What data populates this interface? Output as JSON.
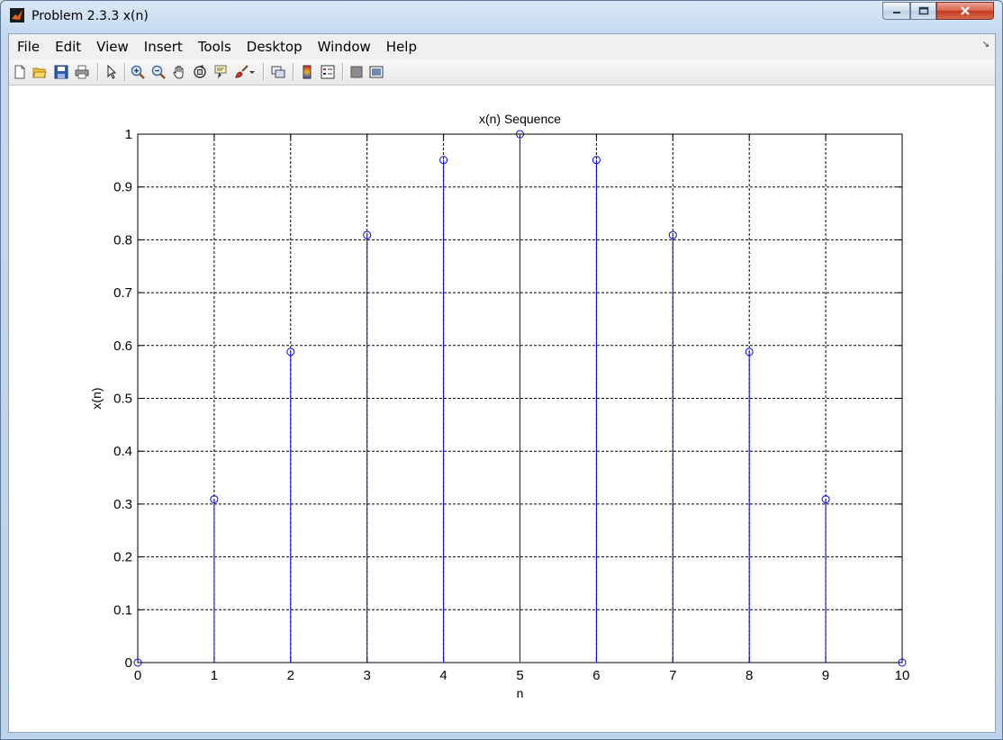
{
  "window": {
    "title": "Problem 2.3.3 x(n)",
    "min_icon": "minimize-icon",
    "max_icon": "maximize-icon",
    "close_icon": "close-icon"
  },
  "menu": {
    "items": [
      "File",
      "Edit",
      "View",
      "Insert",
      "Tools",
      "Desktop",
      "Window",
      "Help"
    ]
  },
  "toolbar": {
    "icons": [
      "new-figure-icon",
      "open-file-icon",
      "save-icon",
      "print-icon",
      "select-arrow-icon",
      "zoom-in-icon",
      "zoom-out-icon",
      "pan-hand-icon",
      "rotate-3d-icon",
      "data-cursor-icon",
      "brush-icon",
      "link-plot-icon",
      "colorbar-icon",
      "legend-icon",
      "hide-plot-tools-icon",
      "show-plot-tools-icon"
    ]
  },
  "colors": {
    "stem": "#0000ff",
    "grid": "#000000",
    "background": "#ffffff"
  },
  "chart_data": {
    "type": "stem",
    "title": "x(n) Sequence",
    "xlabel": "n",
    "ylabel": "x(n)",
    "x": [
      0,
      1,
      2,
      3,
      4,
      5,
      6,
      7,
      8,
      9,
      10
    ],
    "y": [
      0,
      0.309,
      0.588,
      0.809,
      0.951,
      1.0,
      0.951,
      0.809,
      0.588,
      0.309,
      0
    ],
    "xlim": [
      0,
      10
    ],
    "ylim": [
      0,
      1
    ],
    "xticks": [
      "0",
      "1",
      "2",
      "3",
      "4",
      "5",
      "6",
      "7",
      "8",
      "9",
      "10"
    ],
    "yticks": [
      "0",
      "0.1",
      "0.2",
      "0.3",
      "0.4",
      "0.5",
      "0.6",
      "0.7",
      "0.8",
      "0.9",
      "1"
    ],
    "grid": true,
    "marker": "circle"
  }
}
